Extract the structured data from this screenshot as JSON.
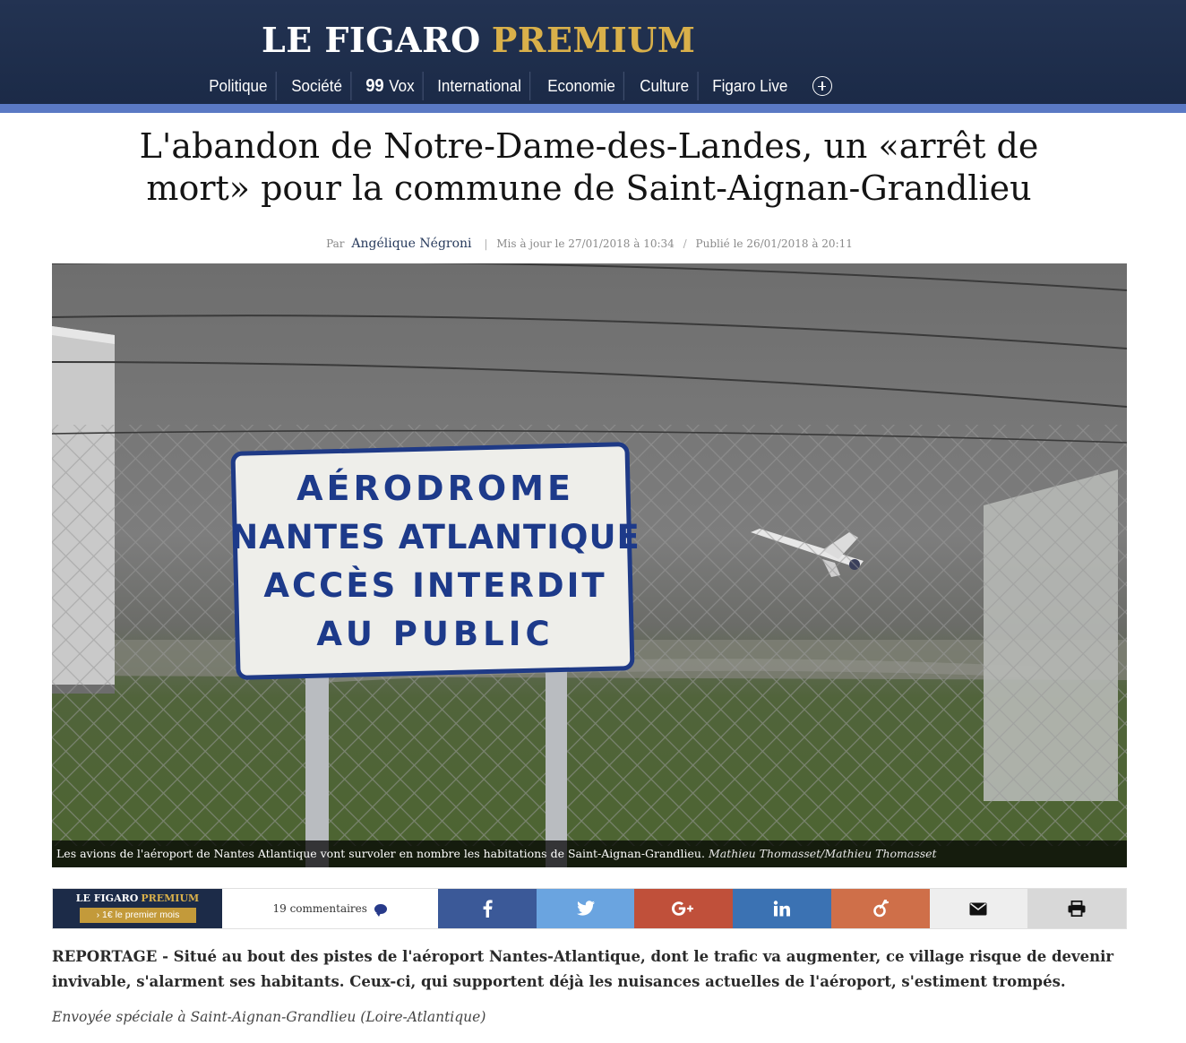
{
  "header": {
    "brand_main": "LE FIGARO",
    "brand_premium": "PREMIUM",
    "nav": [
      "Politique",
      "Société",
      "Vox",
      "International",
      "Economie",
      "Culture",
      "Figaro Live"
    ],
    "vox_quote_glyph": "99",
    "more_icon": "plus-circle-icon"
  },
  "article": {
    "title": "L'abandon de Notre-Dame-des-Landes, un «arrêt de mort» pour la commune de Saint-Aignan-Grandlieu",
    "byline_prefix": "Par",
    "author": "Angélique Négroni",
    "updated": "Mis à jour le 27/01/2018 à 10:34",
    "published": "Publié le 26/01/2018 à 20:11",
    "image": {
      "sign_lines": [
        "AÉRODROME",
        "NANTES ATLANTIQUE",
        "ACCÈS INTERDIT",
        "AU PUBLIC"
      ],
      "caption": "Les avions de l'aéroport de Nantes Atlantique vont survoler en nombre les habitations de Saint-Aignan-Grandlieu.",
      "credit": "Mathieu Thomasset/Mathieu Thomasset"
    },
    "lead": "REPORTAGE - Situé au bout des pistes de l'aéroport Nantes-Atlantique, dont le trafic va augmenter, ce village risque de devenir invivable, s'alarment ses habitants. Ceux-ci, qui supportent déjà les nuisances actuelles de l'aéroport, s'estiment trompés.",
    "dateline": "Envoyée spéciale à Saint-Aignan-Grandlieu (Loire-Atlantique)"
  },
  "sharebar": {
    "promo_brand": "LE FIGARO",
    "promo_premium": "PREMIUM",
    "promo_button": "1€ le premier mois",
    "comments": "19 commentaires",
    "buttons": [
      {
        "name": "facebook",
        "color": "#3b5998"
      },
      {
        "name": "twitter",
        "color": "#6aa4e0"
      },
      {
        "name": "google-plus",
        "color": "#c0503a"
      },
      {
        "name": "linkedin",
        "color": "#3b72b3"
      },
      {
        "name": "viadeo",
        "color": "#cf6f49"
      },
      {
        "name": "email",
        "color": "#eeeeee"
      },
      {
        "name": "print",
        "color": "#d8d8d8"
      }
    ]
  },
  "colors": {
    "header_bg": "#1f2e4c",
    "header_rule": "#5a79c4",
    "premium_gold": "#d9b04a"
  }
}
